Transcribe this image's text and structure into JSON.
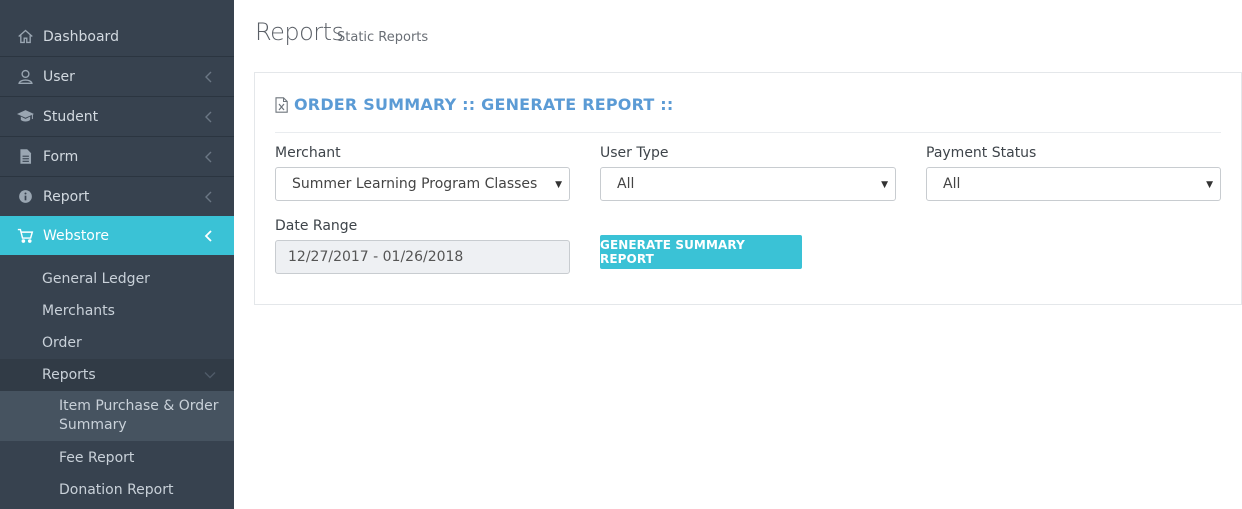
{
  "sidebar": {
    "items": [
      {
        "label": "Dashboard",
        "icon": "home-icon"
      },
      {
        "label": "User",
        "icon": "user-icon"
      },
      {
        "label": "Student",
        "icon": "graduation-cap-icon"
      },
      {
        "label": "Form",
        "icon": "file-icon"
      },
      {
        "label": "Report",
        "icon": "info-icon"
      },
      {
        "label": "Webstore",
        "icon": "cart-icon"
      }
    ],
    "webstore_children": [
      {
        "label": "General Ledger"
      },
      {
        "label": "Merchants"
      },
      {
        "label": "Order"
      },
      {
        "label": "Reports"
      }
    ],
    "reports_children": [
      {
        "label": "Item Purchase & Order Summary"
      },
      {
        "label": "Fee Report"
      },
      {
        "label": "Donation Report"
      }
    ]
  },
  "header": {
    "title": "Reports",
    "subtitle": "Static Reports"
  },
  "panel": {
    "title": "ORDER SUMMARY :: GENERATE REPORT ::",
    "merchant_label": "Merchant",
    "merchant_value": "Summer Learning Program Classes",
    "user_type_label": "User Type",
    "user_type_value": "All",
    "payment_status_label": "Payment Status",
    "payment_status_value": "All",
    "date_range_label": "Date Range",
    "date_range_value": "12/27/2017 - 01/26/2018",
    "generate_button": "GENERATE SUMMARY REPORT"
  },
  "colors": {
    "sidebar_bg": "#37424f",
    "accent": "#3ac2d6",
    "title_blue": "#5b9bd5"
  }
}
